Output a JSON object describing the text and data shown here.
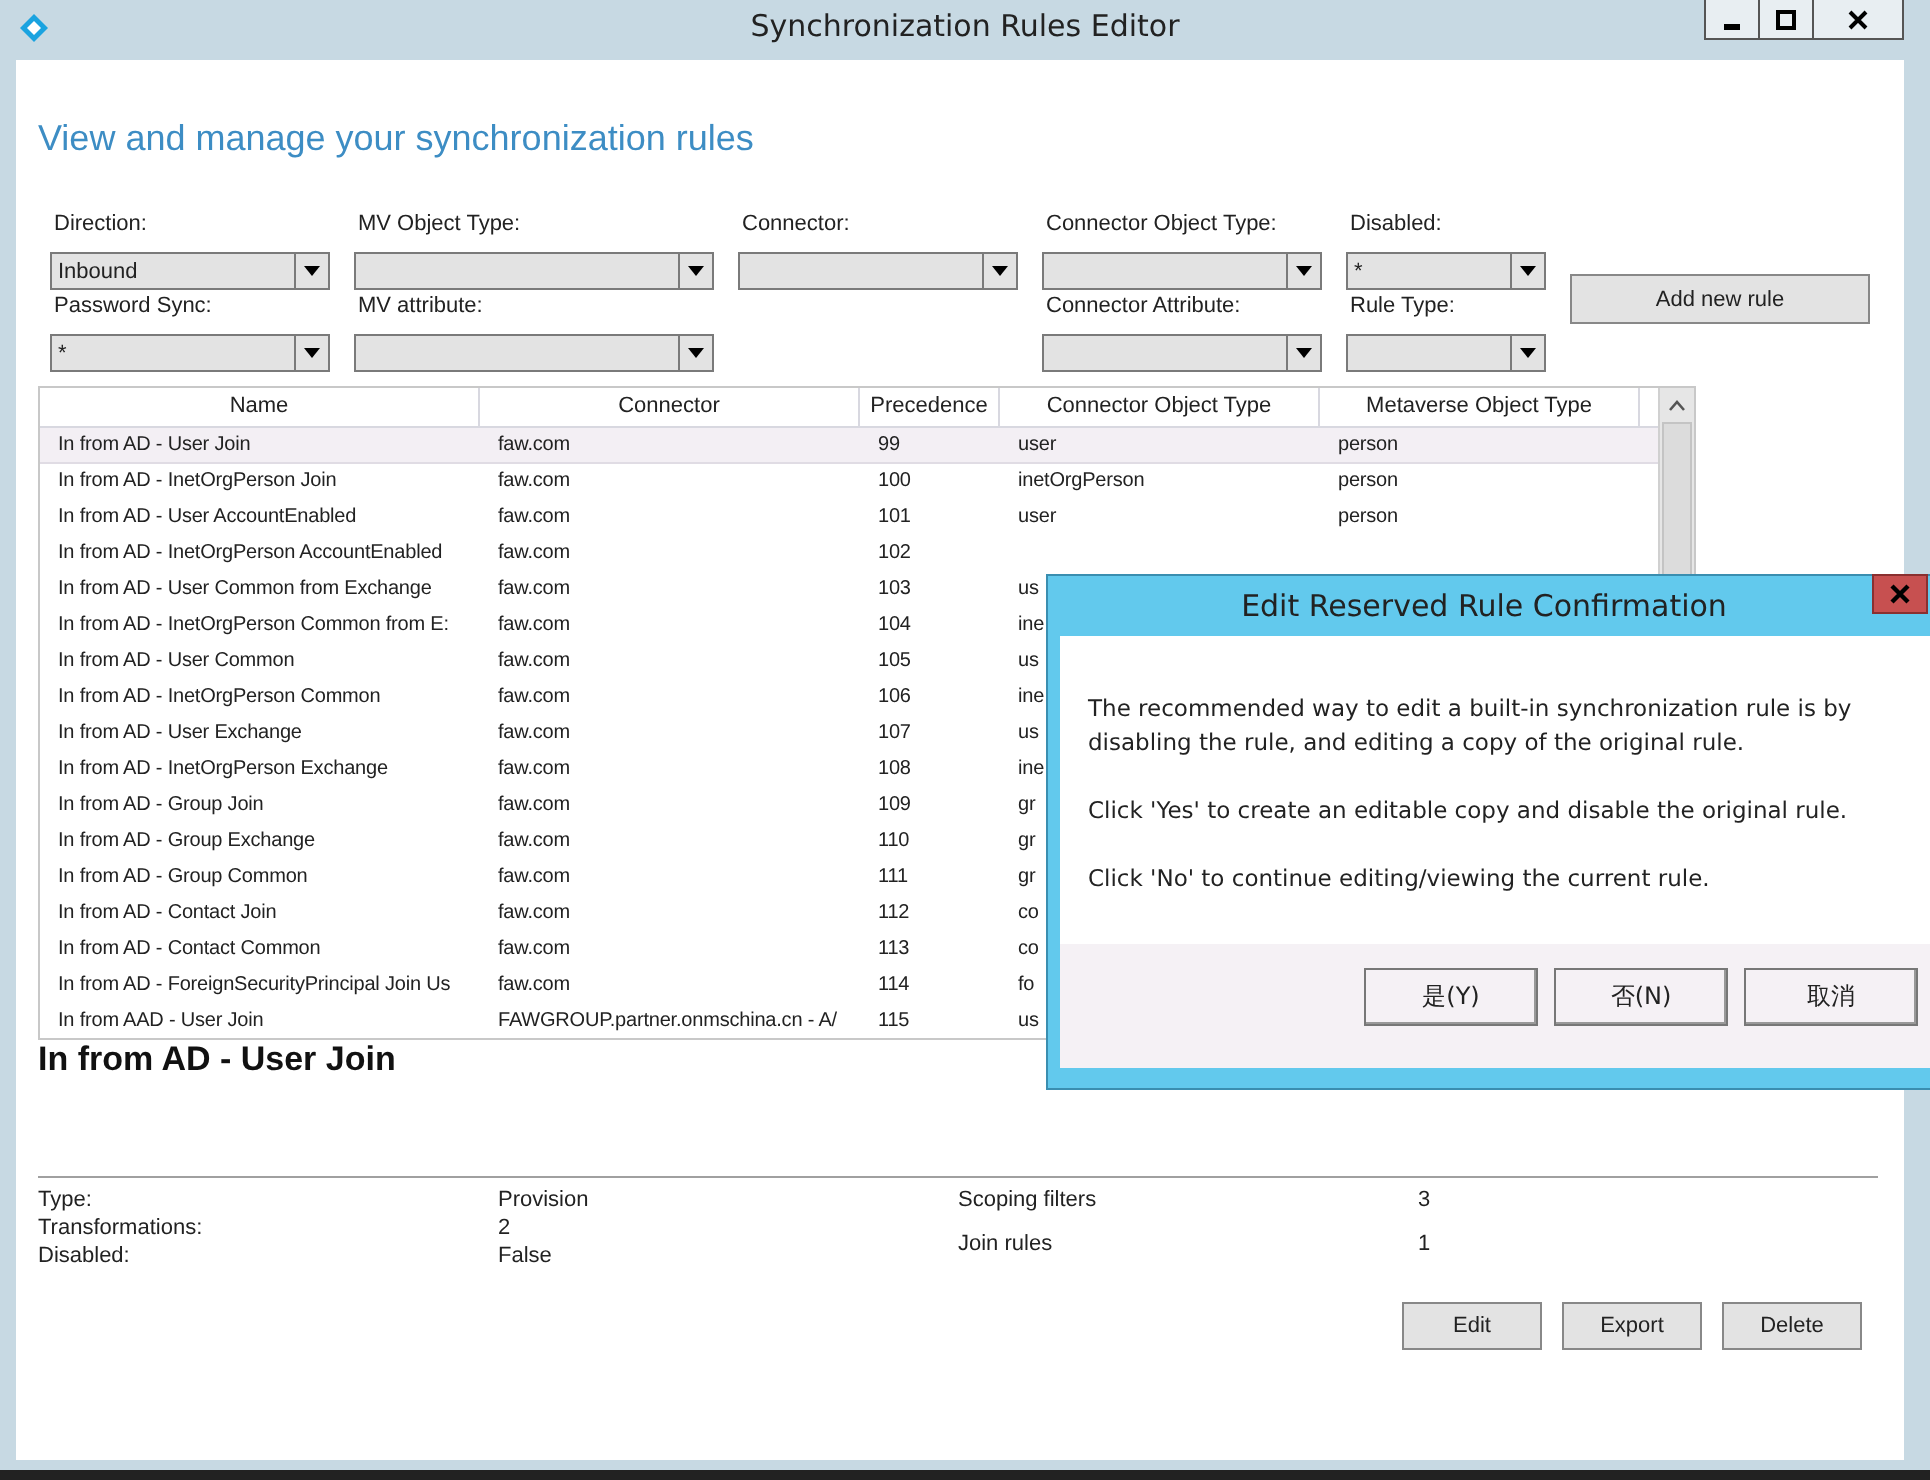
{
  "window": {
    "title": "Synchronization Rules Editor"
  },
  "heading": "View and manage your synchronization rules",
  "filter_rows": [
    [
      {
        "kind": "combo",
        "label": "Direction:",
        "value": "Inbound"
      },
      {
        "kind": "combo",
        "label": "MV Object Type:"
      },
      {
        "kind": "combo",
        "label": "Connector:"
      },
      {
        "kind": "combo",
        "label": "Connector Object Type:"
      },
      {
        "kind": "combo",
        "label": "Disabled:",
        "value": "*"
      }
    ],
    [
      {
        "kind": "combo",
        "label": "Password Sync:",
        "value": "*"
      },
      {
        "kind": "combo",
        "label": "MV attribute:"
      },
      {
        "kind": "empty"
      },
      {
        "kind": "combo",
        "label": "Connector Attribute:"
      },
      {
        "kind": "combo",
        "label": "Rule Type:"
      }
    ]
  ],
  "add_button": "Add new rule",
  "table": {
    "columns": [
      "Name",
      "Connector",
      "Precedence",
      "Connector Object Type",
      "Metaverse Object Type"
    ],
    "rows": [
      {
        "selected": true,
        "cells": [
          "In from AD - User Join",
          "faw.com",
          "99",
          "user",
          "person"
        ]
      },
      {
        "selected": false,
        "cells": [
          "In from AD - InetOrgPerson Join",
          "faw.com",
          "100",
          "inetOrgPerson",
          "person"
        ]
      },
      {
        "selected": false,
        "cells": [
          "In from AD - User AccountEnabled",
          "faw.com",
          "101",
          "user",
          "person"
        ]
      },
      {
        "selected": false,
        "cells": [
          "In from AD - InetOrgPerson AccountEnabled",
          "faw.com",
          "102"
        ]
      },
      {
        "selected": false,
        "cells": [
          "In from AD - User Common from Exchange",
          "faw.com",
          "103",
          "us"
        ]
      },
      {
        "selected": false,
        "cells": [
          "In from AD - InetOrgPerson Common from E:",
          "faw.com",
          "104",
          "ine"
        ]
      },
      {
        "selected": false,
        "cells": [
          "In from AD - User Common",
          "faw.com",
          "105",
          "us"
        ]
      },
      {
        "selected": false,
        "cells": [
          "In from AD - InetOrgPerson Common",
          "faw.com",
          "106",
          "ine"
        ]
      },
      {
        "selected": false,
        "cells": [
          "In from AD - User Exchange",
          "faw.com",
          "107",
          "us"
        ]
      },
      {
        "selected": false,
        "cells": [
          "In from AD - InetOrgPerson Exchange",
          "faw.com",
          "108",
          "ine"
        ]
      },
      {
        "selected": false,
        "cells": [
          "In from AD - Group Join",
          "faw.com",
          "109",
          "gr"
        ]
      },
      {
        "selected": false,
        "cells": [
          "In from AD - Group Exchange",
          "faw.com",
          "110",
          "gr"
        ]
      },
      {
        "selected": false,
        "cells": [
          "In from AD - Group Common",
          "faw.com",
          "111",
          "gr"
        ]
      },
      {
        "selected": false,
        "cells": [
          "In from AD - Contact Join",
          "faw.com",
          "112",
          "co"
        ]
      },
      {
        "selected": false,
        "cells": [
          "In from AD - Contact Common",
          "faw.com",
          "113",
          "co"
        ]
      },
      {
        "selected": false,
        "cells": [
          "In from AD - ForeignSecurityPrincipal Join Us",
          "faw.com",
          "114",
          "fo"
        ]
      },
      {
        "selected": false,
        "cells": [
          "In from AAD - User Join",
          "FAWGROUP.partner.onmschina.cn - A/",
          "115",
          "us"
        ]
      }
    ]
  },
  "detail": {
    "title": "In from AD - User Join",
    "left": [
      {
        "label": "Type:",
        "value": "Provision"
      },
      {
        "label": "Transformations:",
        "value": "2"
      },
      {
        "label": "Disabled:",
        "value": "False"
      }
    ],
    "right": [
      {
        "label": "Scoping filters",
        "value": "3"
      },
      {
        "label": "Join rules",
        "value": "1"
      }
    ],
    "buttons": [
      "Edit",
      "Export",
      "Delete"
    ]
  },
  "dialog": {
    "title": "Edit Reserved Rule Confirmation",
    "paragraphs": [
      "The recommended way to edit a built-in synchronization rule is by disabling the rule, and editing a copy of the original rule.",
      "Click 'Yes' to create an editable copy and disable the original rule.",
      "Click 'No' to continue editing/viewing the current rule."
    ],
    "buttons": [
      "是(Y)",
      "否(N)",
      "取消"
    ]
  }
}
